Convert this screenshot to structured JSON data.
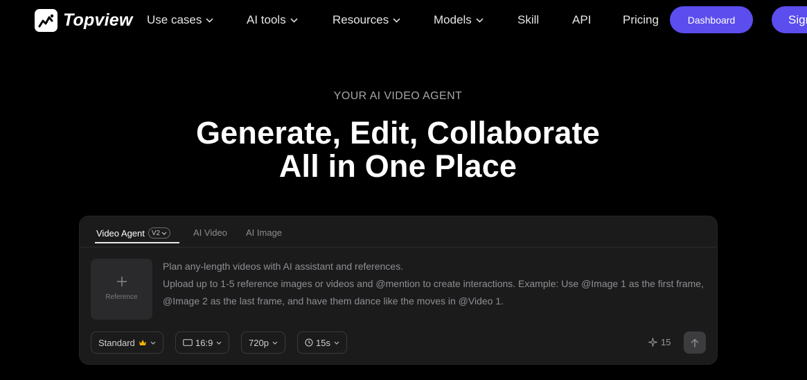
{
  "nav": {
    "brand": "Topview",
    "items": [
      {
        "label": "Use cases",
        "dropdown": true
      },
      {
        "label": "AI tools",
        "dropdown": true
      },
      {
        "label": "Resources",
        "dropdown": true
      },
      {
        "label": "Models",
        "dropdown": true
      },
      {
        "label": "Skill",
        "dropdown": false
      },
      {
        "label": "API",
        "dropdown": false
      },
      {
        "label": "Pricing",
        "dropdown": false
      }
    ],
    "dashboard_label": "Dashboard",
    "signin_label": "Sign"
  },
  "hero": {
    "eyebrow": "YOUR AI VIDEO AGENT",
    "headline_line1": "Generate, Edit, Collaborate",
    "headline_line2": "All in One Place"
  },
  "composer": {
    "tabs": [
      {
        "label": "Video Agent",
        "badge": "V2",
        "active": true
      },
      {
        "label": "AI Video",
        "active": false
      },
      {
        "label": "AI Image",
        "active": false
      }
    ],
    "reference_label": "Reference",
    "prompt_line1": "Plan any-length videos with AI assistant and references.",
    "prompt_line2": "Upload up to 1-5 reference images or videos and @mention to create interactions. Example: Use @Image 1 as the first frame, @Image 2 as the last frame, and have them dance like the moves in @Video 1.",
    "options": {
      "quality": "Standard",
      "aspect": "16:9",
      "resolution": "720p",
      "duration": "15s"
    },
    "credits": "15"
  },
  "colors": {
    "accent": "#5b4dee",
    "background": "#000000",
    "panel": "#1b1b1c",
    "crown": "#f5b301"
  }
}
